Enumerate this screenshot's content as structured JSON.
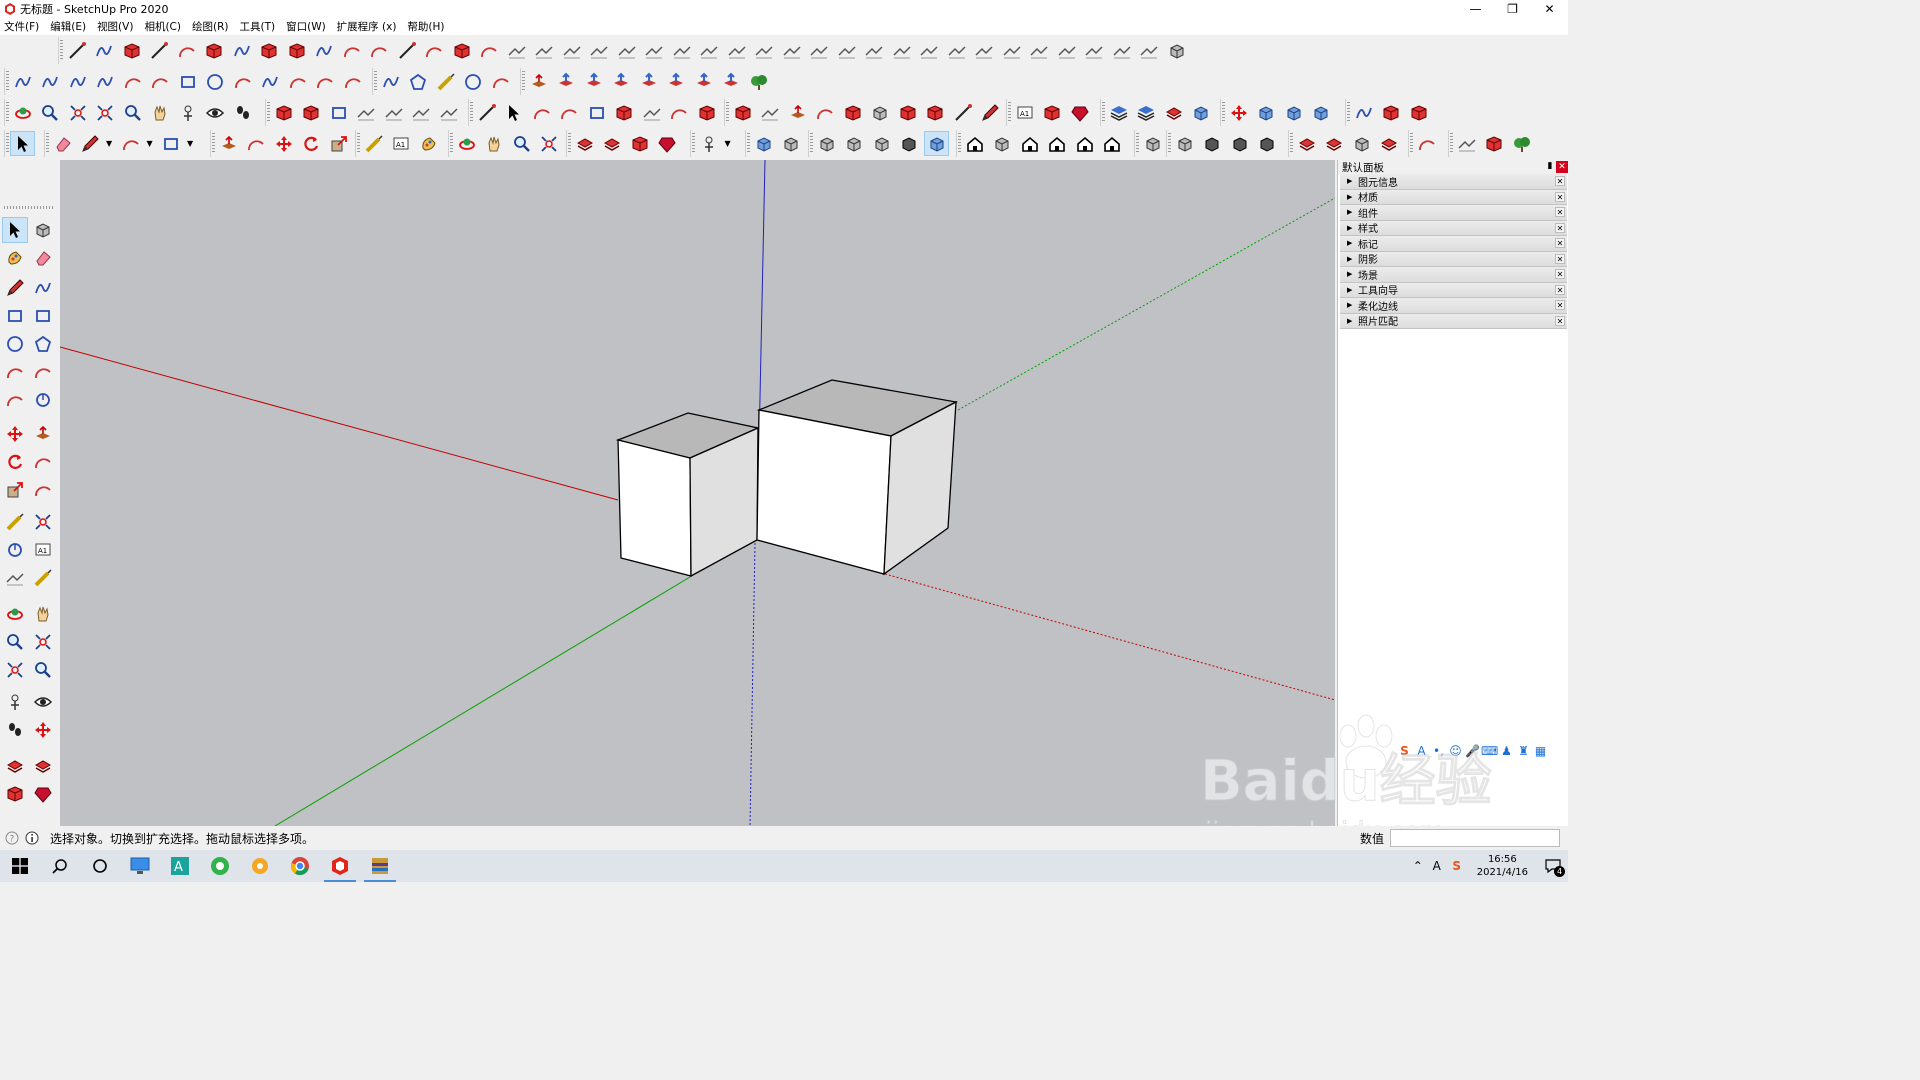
{
  "window": {
    "title": "无标题 - SketchUp Pro 2020",
    "controls": [
      "minimize",
      "restore",
      "close"
    ]
  },
  "menu": [
    "文件(F)",
    "编辑(E)",
    "视图(V)",
    "相机(C)",
    "绘图(R)",
    "工具(T)",
    "窗口(W)",
    "扩展程序 (x)",
    "帮助(H)"
  ],
  "tray": {
    "title": "默认面板",
    "panels": [
      "图元信息",
      "材质",
      "组件",
      "样式",
      "标记",
      "阴影",
      "场景",
      "工具向导",
      "柔化边线",
      "照片匹配"
    ]
  },
  "status": {
    "hint": "选择对象。切换到扩充选择。拖动鼠标选择多项。",
    "measurements_label": "数值",
    "measurements_value": ""
  },
  "taskbar": {
    "time": "16:56",
    "date": "2021/4/16",
    "notification_count": "4"
  },
  "ime": {
    "mode": "A"
  },
  "watermark": {
    "text": "Baidu经验",
    "url": "jingyan.baidu.com"
  },
  "colors": {
    "viewport_bg": "#c0c1c5",
    "axis_red": "#c00000",
    "axis_green": "#00a000",
    "axis_blue": "#2020c0",
    "face_front": "#ffffff",
    "face_side": "#e0e0e0",
    "face_top": "#b8b8b8"
  }
}
